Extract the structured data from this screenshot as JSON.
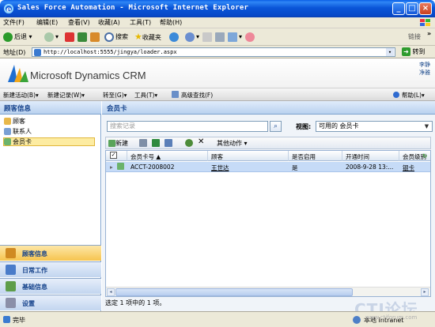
{
  "window": {
    "title": "Sales Force Automation - Microsoft Internet Explorer",
    "buttons": {
      "minimize": "_",
      "maximize": "□",
      "close": "×"
    }
  },
  "menubar": [
    "文件(F)",
    "编辑(E)",
    "查看(V)",
    "收藏(A)",
    "工具(T)",
    "帮助(H)"
  ],
  "toolbar": {
    "back": "后退",
    "search": "搜索",
    "favorites": "收藏夹",
    "links": "链接"
  },
  "address": {
    "label": "地址(D)",
    "url": "http://localhost:5555/jingya/loader.aspx",
    "go": "转到"
  },
  "crm": {
    "brand": "Microsoft Dynamics CRM",
    "user_line1": "李静",
    "user_line2": "净雅",
    "menu": [
      "新建活动(B)▾",
      "新建记录(W)▾",
      "转至(G)▾",
      "工具(T)▾",
      "高级查找(F)",
      "帮助(L)▾"
    ]
  },
  "leftnav": {
    "header": "顾客信息",
    "items": [
      "顾客",
      "联系人",
      "会员卡"
    ],
    "selected_index": 2,
    "wunderbar": [
      {
        "label": "顾客信息",
        "active": true
      },
      {
        "label": "日常工作",
        "active": false
      },
      {
        "label": "基础信息",
        "active": false
      },
      {
        "label": "设置",
        "active": false
      }
    ]
  },
  "main": {
    "title": "会员卡",
    "search_placeholder": "搜索记录",
    "view_label": "视图:",
    "view_value": "可用的 会员卡",
    "grid_toolbar": {
      "new": "新建",
      "more_actions": "其他动作"
    },
    "columns": [
      "会员卡号",
      "顾客",
      "是否启用",
      "开通时间",
      "会员级别"
    ],
    "rows": [
      {
        "card_no": "ACCT-2008002",
        "customer": "王世达",
        "enabled": "是",
        "open_time": "2008-9-28 13:...",
        "level": "银卡"
      }
    ],
    "status": "选定 1 项中的 1 项。"
  },
  "statusbar": {
    "text": "完毕",
    "zone": "本地 Intranet"
  },
  "watermark": {
    "main": "CTI论坛",
    "sub": "www.ctiforum.com"
  }
}
